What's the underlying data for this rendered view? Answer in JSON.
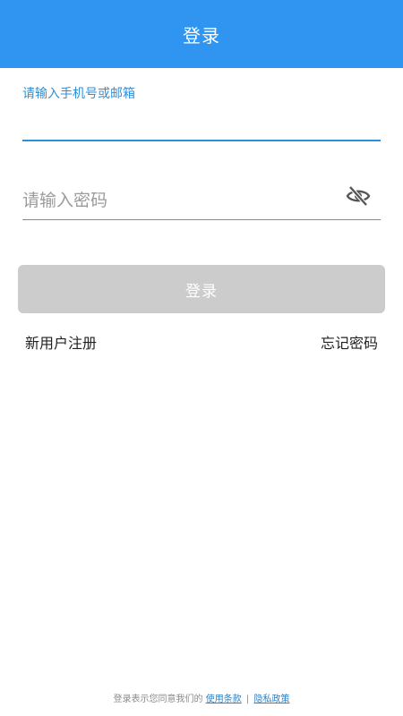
{
  "header": {
    "title": "登录"
  },
  "account_field": {
    "label": "请输入手机号或邮箱",
    "value": ""
  },
  "password_field": {
    "placeholder": "请输入密码",
    "toggle_icon": "eye-off-icon"
  },
  "login_button": {
    "label": "登录"
  },
  "links": {
    "register": "新用户注册",
    "forgot_password": "忘记密码"
  },
  "footer": {
    "prefix": "登录表示您同意我们的",
    "terms": "使用条款",
    "separator": "|",
    "privacy": "隐私政策"
  },
  "colors": {
    "accent": "#2f95f0",
    "link_blue": "#2f8fd6",
    "button_disabled": "#cccccc"
  }
}
